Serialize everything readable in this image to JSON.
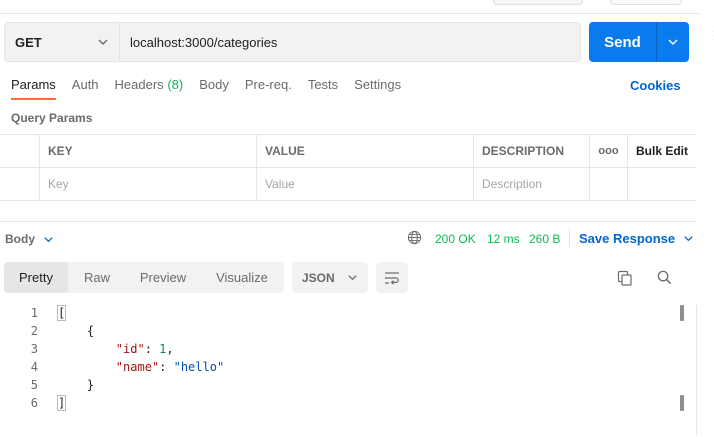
{
  "request": {
    "method": "GET",
    "url": "localhost:3000/categories",
    "send_label": "Send"
  },
  "tabs": [
    {
      "label": "Params",
      "active": true
    },
    {
      "label": "Auth"
    },
    {
      "label": "Headers",
      "count": "(8)"
    },
    {
      "label": "Body"
    },
    {
      "label": "Pre-req."
    },
    {
      "label": "Tests"
    },
    {
      "label": "Settings"
    }
  ],
  "cookies_label": "Cookies",
  "query_params": {
    "title": "Query Params",
    "columns": [
      "KEY",
      "VALUE",
      "DESCRIPTION"
    ],
    "more_icon": "ooo",
    "bulk_edit_label": "Bulk Edit",
    "placeholders": {
      "key": "Key",
      "value": "Value",
      "description": "Description"
    }
  },
  "response": {
    "body_label": "Body",
    "status": "200 OK",
    "time": "12 ms",
    "size": "260 B",
    "save_label": "Save Response",
    "view_tabs": [
      "Pretty",
      "Raw",
      "Preview",
      "Visualize"
    ],
    "active_view": "Pretty",
    "format": "JSON",
    "lines": [
      {
        "num": "1",
        "text": "["
      },
      {
        "num": "2",
        "text": "    {"
      },
      {
        "num": "3",
        "key": "\"id\"",
        "sep": ": ",
        "value": "1",
        "suffix": ","
      },
      {
        "num": "4",
        "key": "\"name\"",
        "sep": ": ",
        "value": "\"hello\""
      },
      {
        "num": "5",
        "text": "    }"
      },
      {
        "num": "6",
        "text": "]"
      }
    ]
  },
  "colors": {
    "accent": "#097bed",
    "status_ok": "#0cbb52",
    "link": "#0265d2",
    "active_tab_underline": "#ff6c37"
  },
  "icons": [
    "chevron-down-icon",
    "globe-icon",
    "wrap-lines-icon",
    "copy-icon",
    "search-icon"
  ]
}
